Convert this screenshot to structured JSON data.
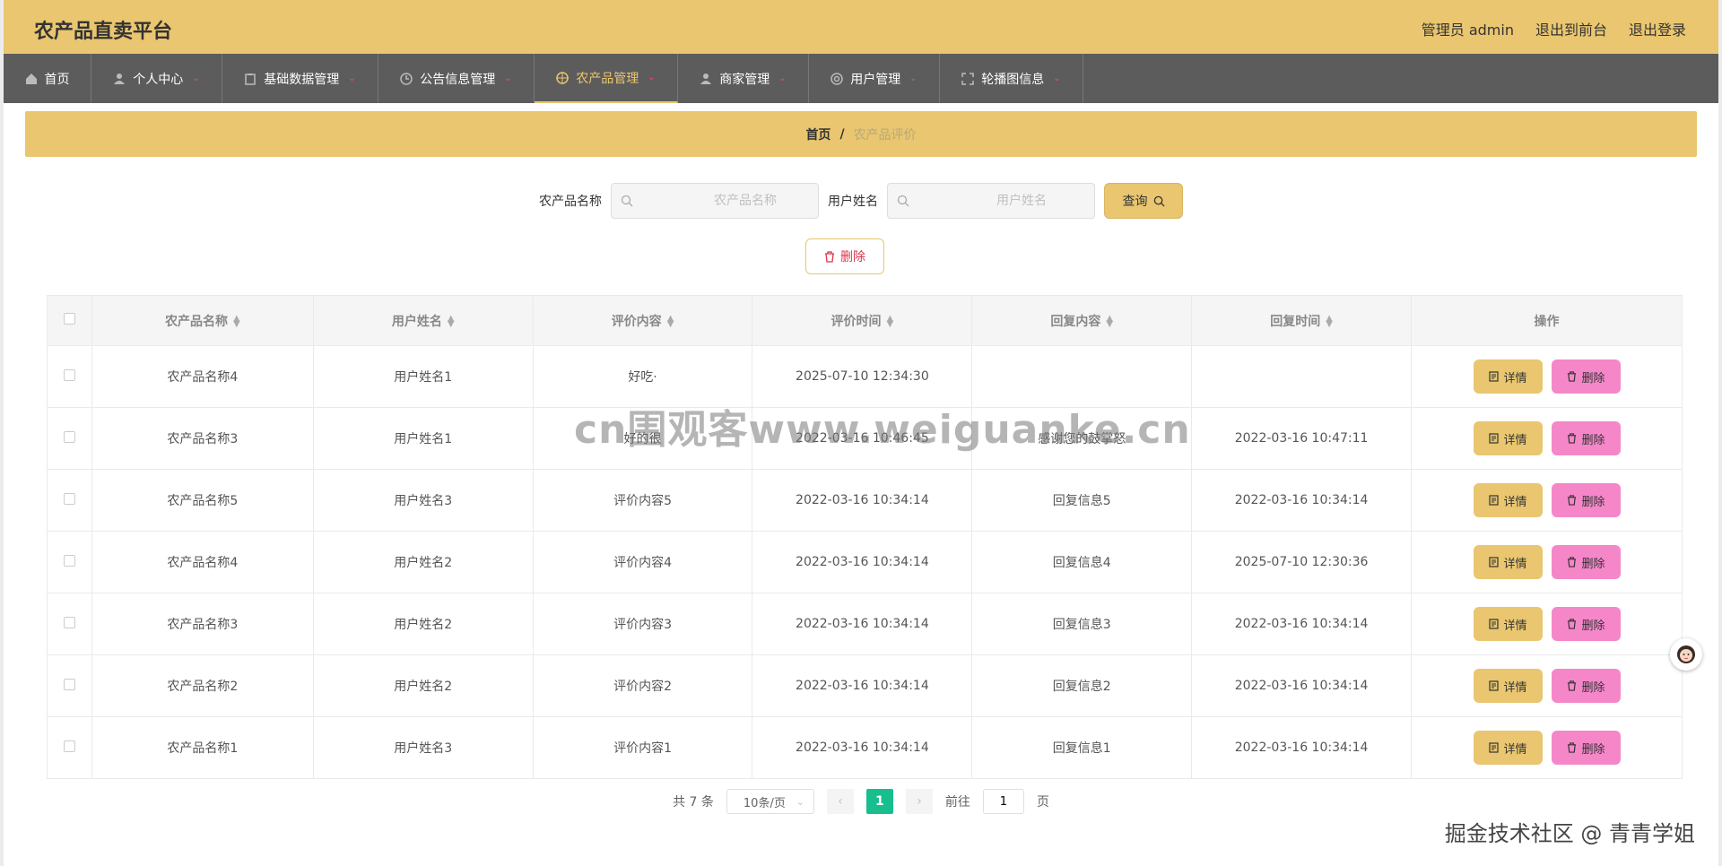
{
  "header": {
    "title": "农产品直卖平台",
    "admin_label": "管理员 admin",
    "to_front": "退出到前台",
    "logout": "退出登录"
  },
  "nav": {
    "items": [
      {
        "label": "首页",
        "icon": "home-icon"
      },
      {
        "label": "个人中心",
        "icon": "user-icon"
      },
      {
        "label": "基础数据管理",
        "icon": "clipboard-icon"
      },
      {
        "label": "公告信息管理",
        "icon": "clock-icon"
      },
      {
        "label": "农产品管理",
        "icon": "target-icon"
      },
      {
        "label": "商家管理",
        "icon": "user-icon"
      },
      {
        "label": "用户管理",
        "icon": "circle-icon"
      },
      {
        "label": "轮播图信息",
        "icon": "fullscreen-icon"
      }
    ],
    "active": "农产品管理"
  },
  "breadcrumb": {
    "home": "首页",
    "sep": "/",
    "current": "农产品评价"
  },
  "search": {
    "product_label": "农产品名称",
    "product_placeholder": "农产品名称",
    "user_label": "用户姓名",
    "user_placeholder": "用户姓名",
    "query_button": "查询"
  },
  "toolbar": {
    "delete_button": "删除"
  },
  "table": {
    "columns": [
      "农产品名称",
      "用户姓名",
      "评价内容",
      "评价时间",
      "回复内容",
      "回复时间",
      "操作"
    ],
    "rows": [
      {
        "product": "农产品名称4",
        "user": "用户姓名1",
        "content": "好吃·",
        "time": "2025-07-10 12:34:30",
        "reply": "",
        "reply_time": ""
      },
      {
        "product": "农产品名称3",
        "user": "用户姓名1",
        "content": "好的很",
        "time": "2022-03-16 10:46:45",
        "reply": "感谢您的鼓掌怒",
        "reply_time": "2022-03-16 10:47:11"
      },
      {
        "product": "农产品名称5",
        "user": "用户姓名3",
        "content": "评价内容5",
        "time": "2022-03-16 10:34:14",
        "reply": "回复信息5",
        "reply_time": "2022-03-16 10:34:14"
      },
      {
        "product": "农产品名称4",
        "user": "用户姓名2",
        "content": "评价内容4",
        "time": "2022-03-16 10:34:14",
        "reply": "回复信息4",
        "reply_time": "2025-07-10 12:30:36"
      },
      {
        "product": "农产品名称3",
        "user": "用户姓名2",
        "content": "评价内容3",
        "time": "2022-03-16 10:34:14",
        "reply": "回复信息3",
        "reply_time": "2022-03-16 10:34:14"
      },
      {
        "product": "农产品名称2",
        "user": "用户姓名2",
        "content": "评价内容2",
        "time": "2022-03-16 10:34:14",
        "reply": "回复信息2",
        "reply_time": "2022-03-16 10:34:14"
      },
      {
        "product": "农产品名称1",
        "user": "用户姓名3",
        "content": "评价内容1",
        "time": "2022-03-16 10:34:14",
        "reply": "回复信息1",
        "reply_time": "2022-03-16 10:34:14"
      }
    ],
    "detail_label": "详情",
    "delete_label": "删除"
  },
  "pagination": {
    "total": "共 7 条",
    "page_size": "10条/页",
    "current_page": "1",
    "goto_label": "前往",
    "goto_value": "1",
    "page_suffix": "页"
  },
  "overlay": {
    "watermark": "cn围观客www.weiguanke.cn",
    "credit": "掘金技术社区 @ 青青学姐"
  },
  "colors": {
    "accent": "#e9c66f",
    "nav_bg": "#5d5c5c",
    "delete_pink": "#f587c9",
    "pager_green": "#19be8e",
    "danger_red": "#e0334a"
  }
}
